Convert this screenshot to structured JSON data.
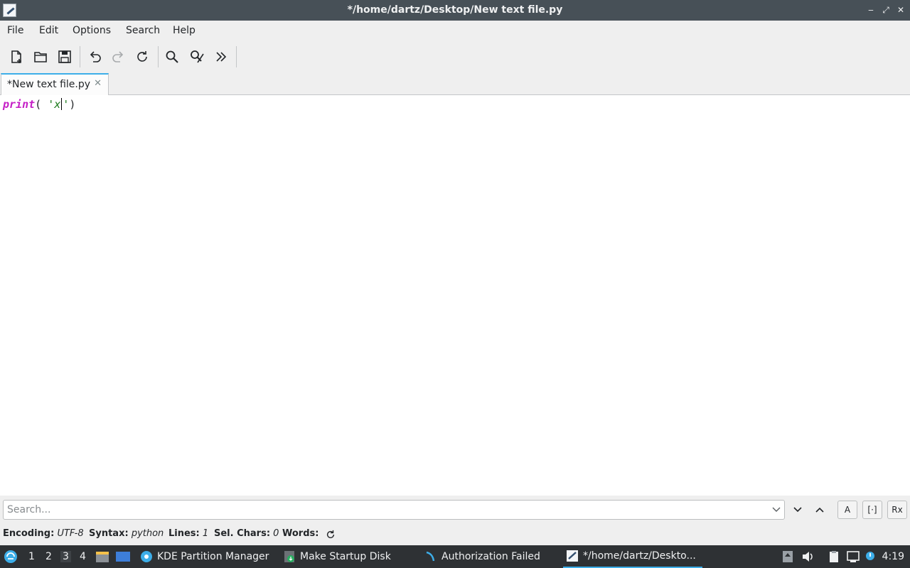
{
  "window": {
    "title": "*/home/dartz/Desktop/New text file.py",
    "minimize": "‒",
    "maximize": "⤢",
    "close": "✕"
  },
  "menu": [
    "File",
    "Edit",
    "Options",
    "Search",
    "Help"
  ],
  "toolbar": {
    "icons": [
      "new-file-icon",
      "open-folder-icon",
      "save-icon",
      "undo-icon",
      "redo-icon",
      "reload-icon",
      "find-icon",
      "replace-icon",
      "more-icon"
    ]
  },
  "tabs": [
    {
      "label": "*New text file.py",
      "close": "✕"
    }
  ],
  "editor": {
    "keyword": "print",
    "open_paren": "(",
    "string_open": "'x",
    "string_close": "'",
    "close_paren": ")"
  },
  "search": {
    "placeholder": "Search...",
    "case_button": "A",
    "whole_word_button": "[·]",
    "regex_button": "Rx"
  },
  "status": {
    "encoding_label": "Encoding:",
    "encoding_value": "UTF-8",
    "syntax_label": "Syntax:",
    "syntax_value": "python",
    "lines_label": "Lines:",
    "lines_value": "1",
    "sel_label": "Sel. Chars:",
    "sel_value": "0",
    "words_label": "Words:"
  },
  "taskbar": {
    "desktops": [
      "1",
      "2",
      "3",
      "4"
    ],
    "active_desktop": "3",
    "tasks": [
      {
        "label": "KDE Partition Manager",
        "icon": "partition-manager-icon"
      },
      {
        "label": "Make Startup Disk",
        "icon": "startup-disk-icon"
      },
      {
        "label": "Authorization Failed",
        "icon": "authorization-icon"
      },
      {
        "label": "*/home/dartz/Deskto...",
        "icon": "text-editor-icon"
      }
    ],
    "clock": "4:19"
  },
  "colors": {
    "accent": "#3daee9",
    "keyword": "#c51fc6",
    "string": "#1b7a1b",
    "titlebar": "#475057",
    "taskbar": "#2e3134"
  }
}
